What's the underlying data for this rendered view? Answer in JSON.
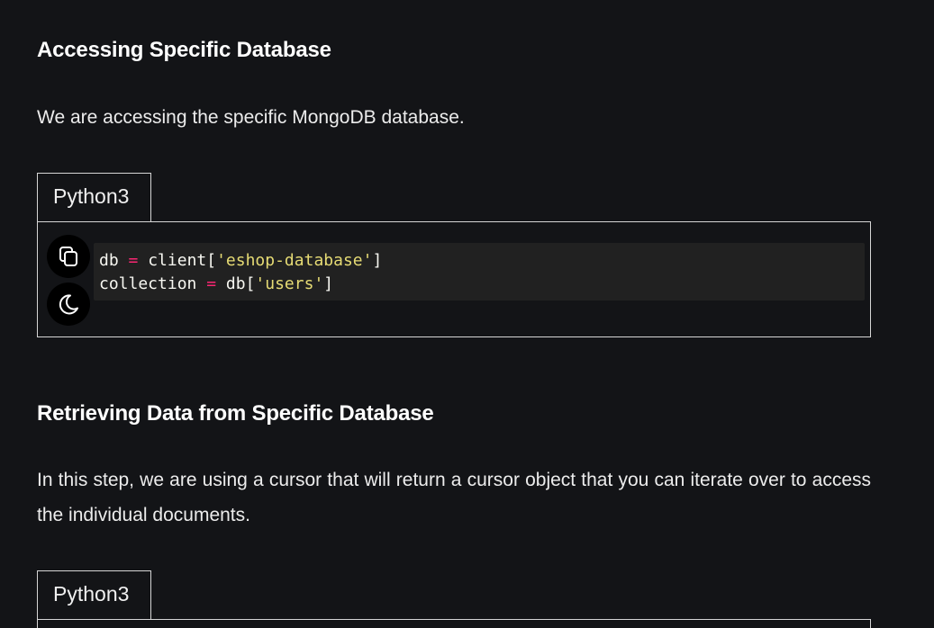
{
  "section1": {
    "heading": "Accessing Specific Database",
    "paragraph": "We are accessing the specific MongoDB database.",
    "code_tab": "Python3",
    "code": {
      "line1": {
        "var": "db",
        "op": "=",
        "call": "client[",
        "str": "'eshop-database'",
        "close": "]"
      },
      "line2": {
        "var": "collection",
        "op": "=",
        "call": "db[",
        "str": "'users'",
        "close": "]"
      }
    },
    "icons": {
      "copy": "copy-icon",
      "theme": "moon-icon"
    }
  },
  "section2": {
    "heading": "Retrieving Data from Specific Database",
    "paragraph": "In this step, we are using a cursor that will return a cursor object that you can iterate over to access the individual documents.",
    "code_tab": "Python3"
  },
  "colors": {
    "background": "#131417",
    "code_background": "#212121",
    "operator": "#f92672",
    "string": "#e6db74"
  }
}
